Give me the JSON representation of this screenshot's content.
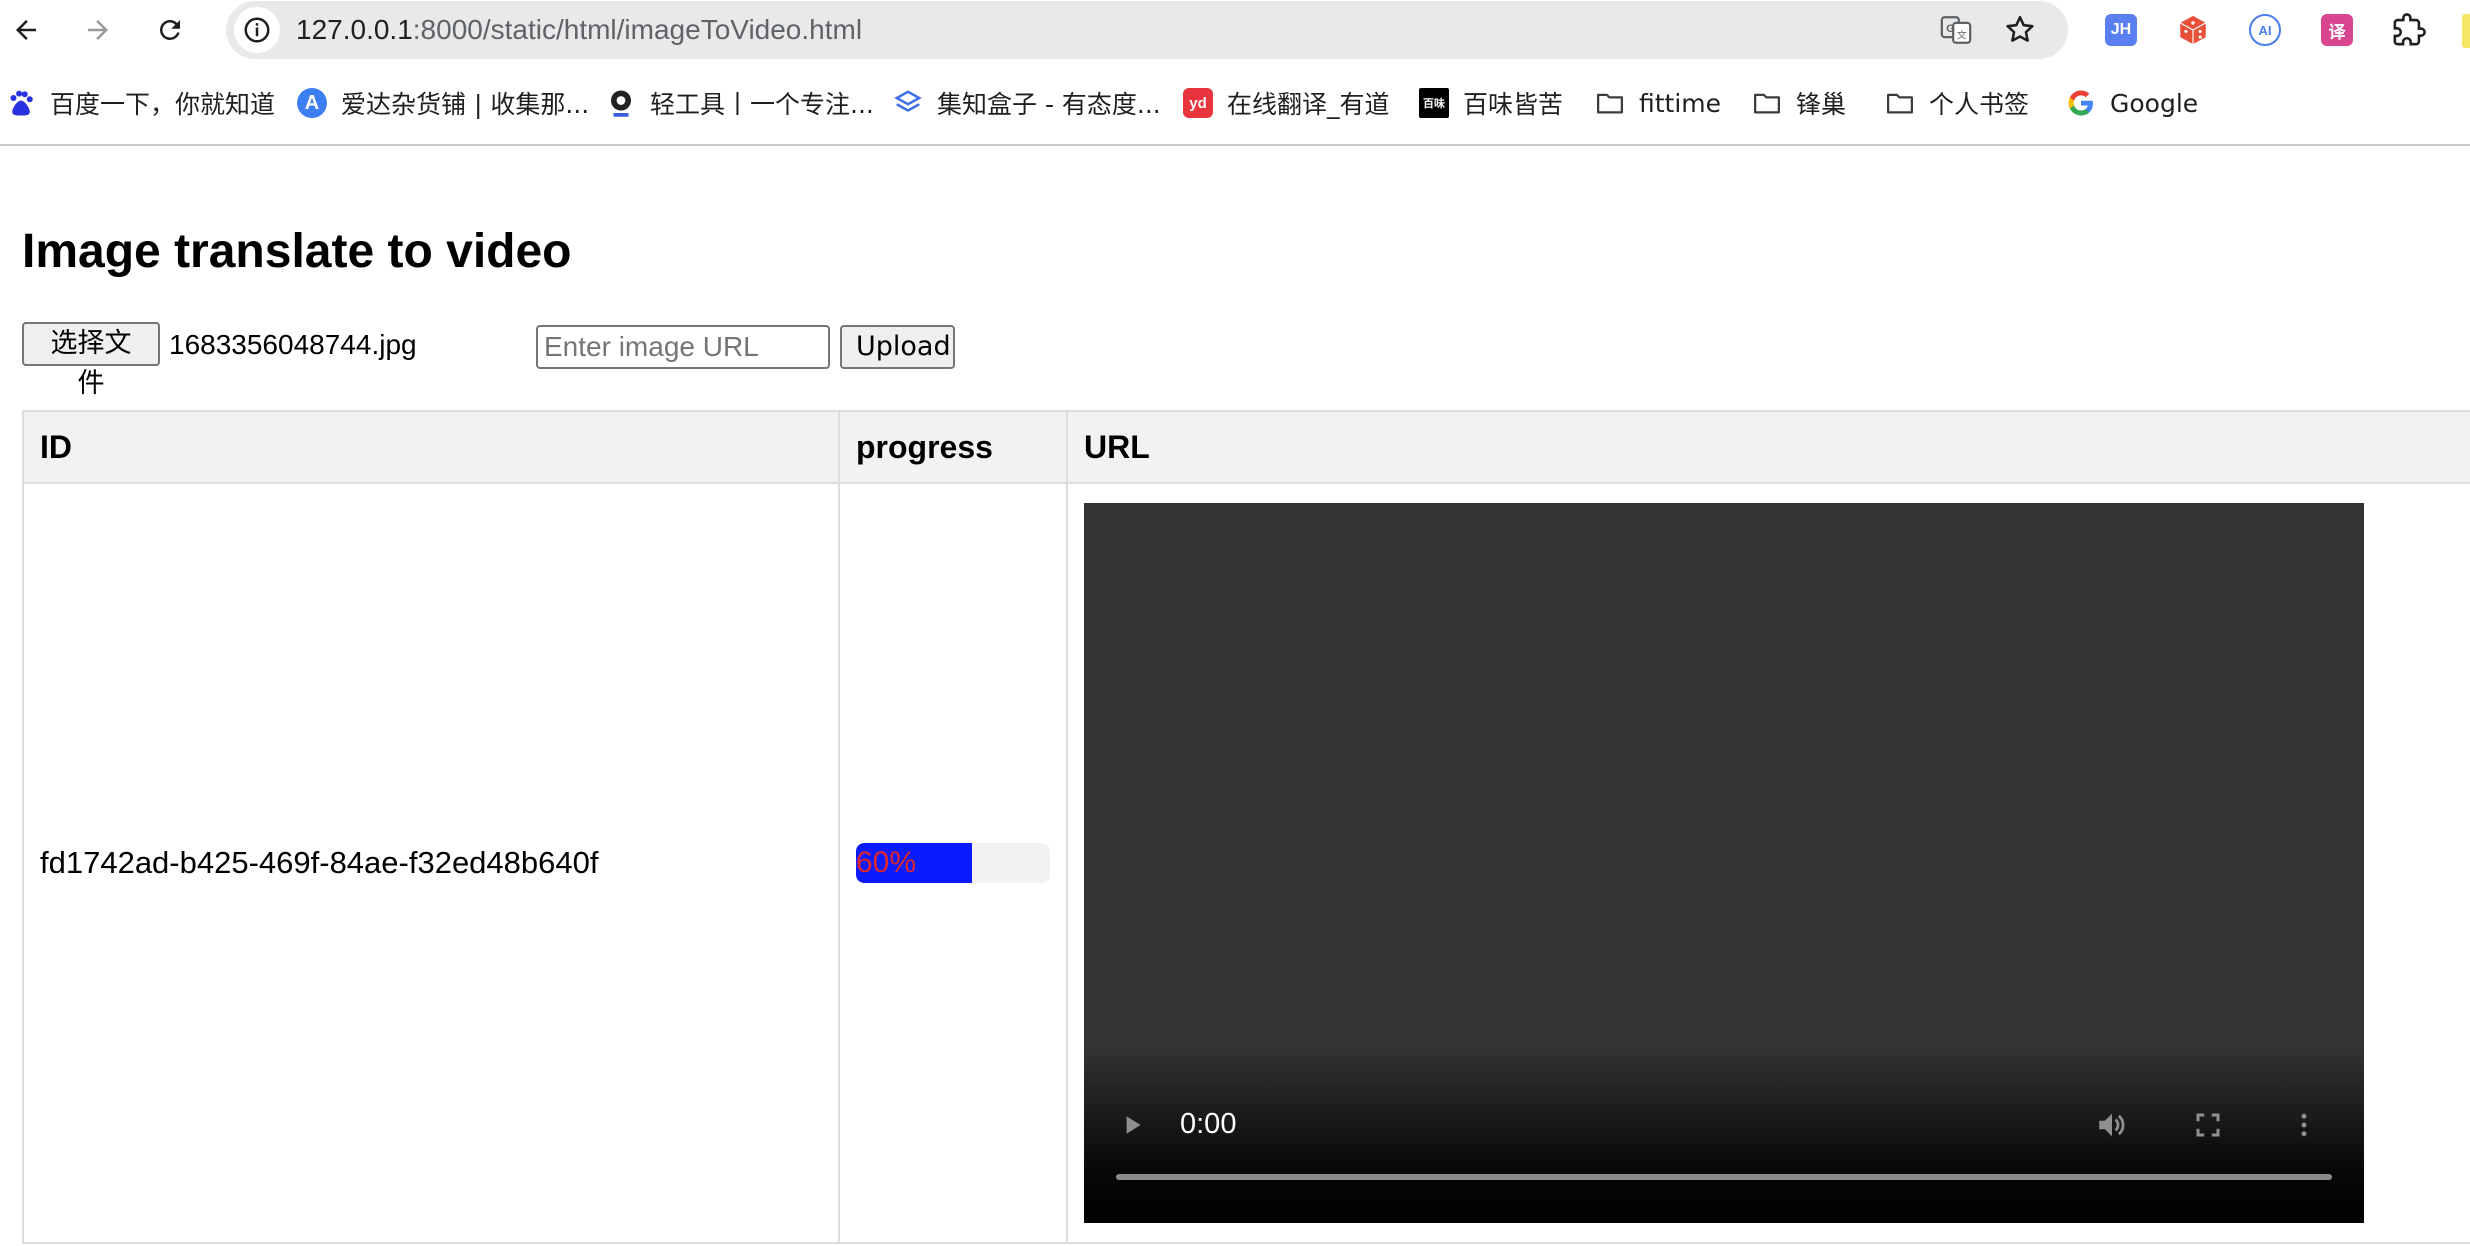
{
  "browser": {
    "url": "127.0.0.1:8000/static/html/imageToVideo.html",
    "url_host": "127.0.0.1",
    "url_rest": ":8000/static/html/imageToVideo.html",
    "extensions": [
      {
        "name": "jh-extension",
        "label": "JH",
        "color": "#5a7ff0"
      },
      {
        "name": "dice-extension",
        "label": "",
        "color": "#e8503a"
      },
      {
        "name": "ai-extension",
        "label": "AI",
        "color": "#4a7df0"
      },
      {
        "name": "translate-extension",
        "label": "译",
        "color": "#d9468f"
      }
    ]
  },
  "bookmarks": [
    {
      "label": "百度一下，你就知道",
      "icon": "baidu-icon",
      "color": "#2932e1"
    },
    {
      "label": "爱达杂货铺 | 收集那...",
      "icon": "aida-icon",
      "color": "#3d7ff2"
    },
    {
      "label": "轻工具丨一个专注...",
      "icon": "qinggongju-icon",
      "color": "#222222"
    },
    {
      "label": "集知盒子 - 有态度...",
      "icon": "jizhi-icon",
      "color": "#3f6fe8"
    },
    {
      "label": "在线翻译_有道",
      "icon": "youdao-icon",
      "color": "#e8343c"
    },
    {
      "label": "百味皆苦",
      "icon": "baiwei-icon",
      "color": "#000000"
    },
    {
      "label": "fittime",
      "icon": "folder-icon"
    },
    {
      "label": "锋巢",
      "icon": "folder-icon"
    },
    {
      "label": "个人书签",
      "icon": "folder-icon"
    },
    {
      "label": "Google",
      "icon": "google-icon"
    }
  ],
  "page": {
    "title": "Image translate to video",
    "choose_file_label": "选择文件",
    "file_name": "1683356048744.jpg",
    "url_placeholder": "Enter image URL",
    "upload_label": "Upload"
  },
  "table": {
    "headers": {
      "id": "ID",
      "progress": "progress",
      "url": "URL"
    },
    "rows": [
      {
        "id": "fd1742ad-b425-469f-84ae-f32ed48b640f",
        "progress": 0.6,
        "progress_label": "60%",
        "video_time": "0:00"
      }
    ]
  },
  "colors": {
    "progress_fill": "#0a1cff",
    "progress_text": "#e0262b",
    "video_background": "#343434"
  }
}
